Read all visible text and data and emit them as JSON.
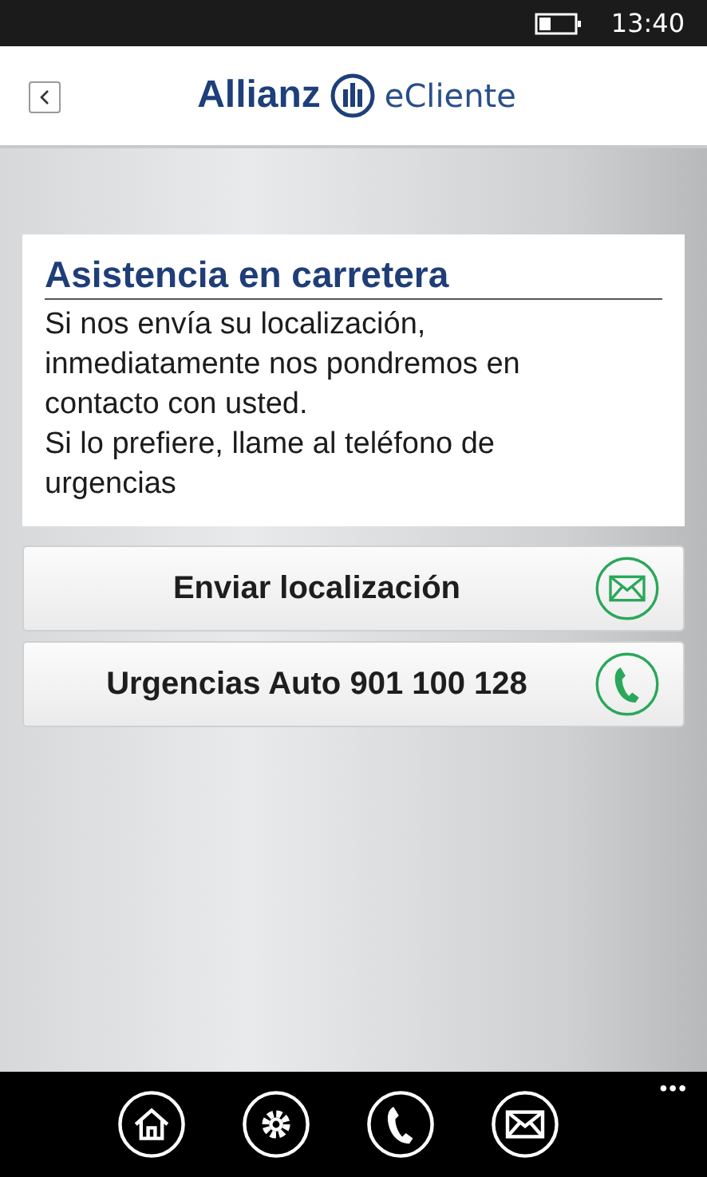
{
  "status_bar": {
    "time": "13:40"
  },
  "header": {
    "brand": "Allianz",
    "product": "eCliente"
  },
  "card": {
    "title": "Asistencia en carretera",
    "paragraphs": [
      "Si nos envía su localización, inmediatamente nos pondremos en contacto con usted.",
      "Si lo prefiere, llame al teléfono de urgencias"
    ]
  },
  "actions": [
    {
      "label": "Enviar localización",
      "kind": "mail"
    },
    {
      "label": "Urgencias Auto 901 100 128",
      "kind": "phone"
    }
  ],
  "app_bar": {
    "more": "•••"
  }
}
